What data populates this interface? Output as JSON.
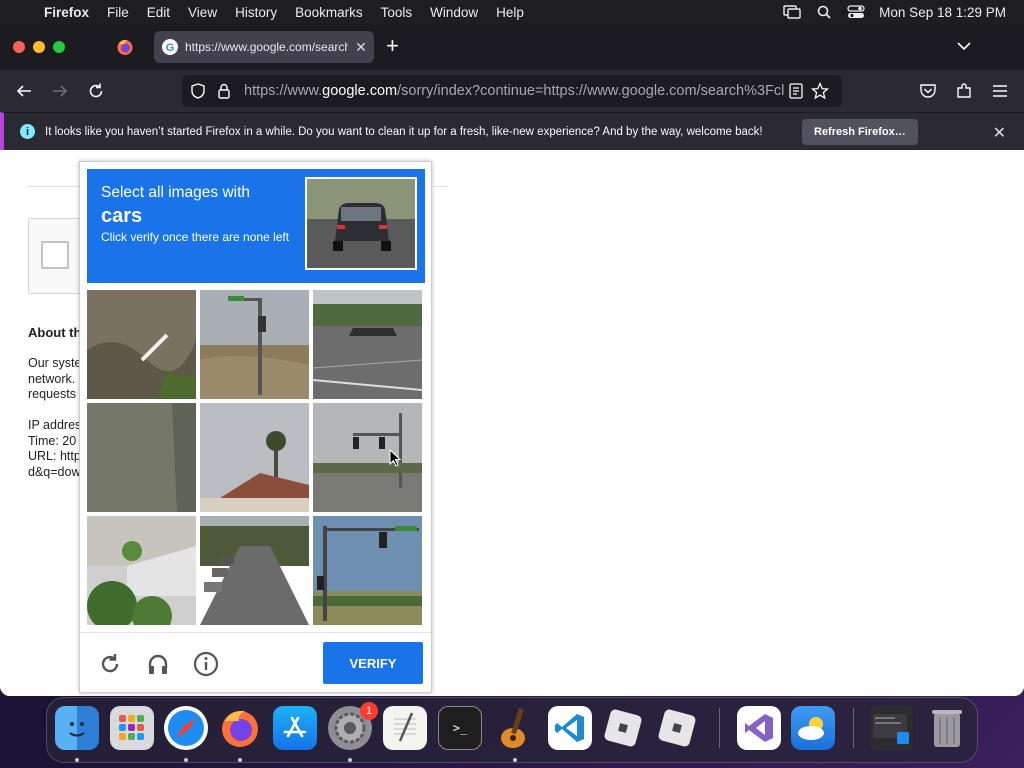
{
  "menubar": {
    "app_name": "Firefox",
    "items": [
      "File",
      "Edit",
      "View",
      "History",
      "Bookmarks",
      "Tools",
      "Window",
      "Help"
    ],
    "clock": "Mon Sep 18  1:29 PM"
  },
  "browser": {
    "tab_title": "https://www.google.com/search",
    "url_host_prefix": "https://www.",
    "url_host": "google.com",
    "url_path": "/sorry/index?continue=https://www.google.com/search%3Fcl",
    "notice_text": "It looks like you haven’t started Firefox in a while. Do you want to clean it up for a fresh, like-new experience? And by the way, welcome back!",
    "notice_button": "Refresh Firefox…"
  },
  "page": {
    "about_heading": "About th",
    "para_lines": [
      "Our syste",
      "network.",
      "requests"
    ],
    "meta_lines": [
      "IP addres",
      "Time: 20",
      "URL: http",
      "d&q=dow"
    ]
  },
  "captcha": {
    "line1": "Select all images with",
    "target": "cars",
    "line3": "Click verify once there are none left",
    "verify_label": "VERIFY",
    "tiles": [
      "gravel-with-cigarette",
      "traffic-light-on-pole",
      "road-with-car",
      "blurred-gravel",
      "palm-tree-and-roof",
      "traffic-lights-intersection",
      "house-with-shrubs",
      "street-with-parked-cars",
      "traffic-light-pole-park"
    ]
  },
  "dock": {
    "apps": [
      "Finder",
      "Launchpad",
      "Safari",
      "Firefox",
      "App Store",
      "System Settings",
      "TextEdit",
      "Terminal",
      "GarageBand",
      "Visual Studio Code",
      "Roblox",
      "Roblox Studio",
      "Visual Studio",
      "Weather",
      "Downloads",
      "Trash"
    ],
    "settings_badge": "1"
  }
}
